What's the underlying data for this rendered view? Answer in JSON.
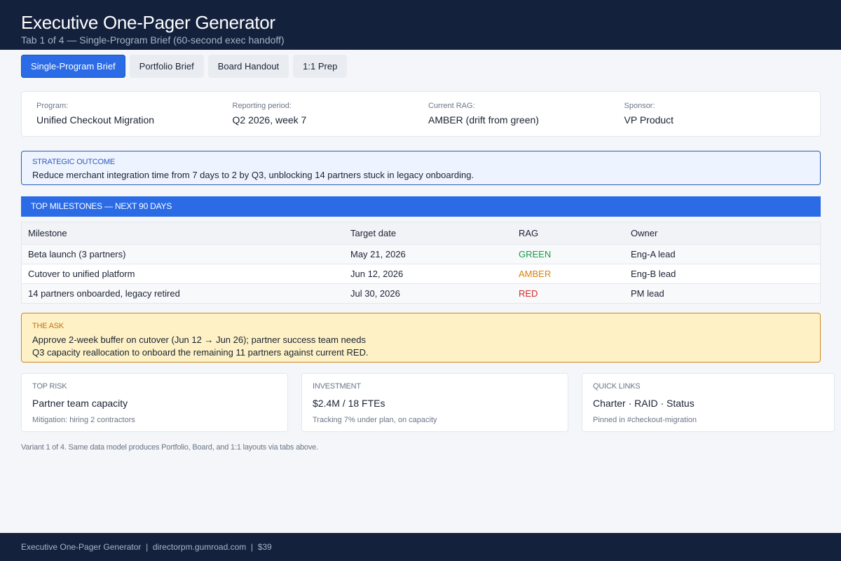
{
  "header": {
    "title": "Executive One-Pager Generator",
    "subtitle": "Tab 1 of 4 — Single-Program Brief (60-second exec handoff)"
  },
  "tabs": [
    {
      "label": "Single-Program Brief",
      "active": true
    },
    {
      "label": "Portfolio Brief",
      "active": false
    },
    {
      "label": "Board Handout",
      "active": false
    },
    {
      "label": "1:1 Prep",
      "active": false
    }
  ],
  "meta": {
    "program_label": "Program:",
    "program_value": "Unified Checkout Migration",
    "period_label": "Reporting period:",
    "period_value": "Q2 2026, week 7",
    "rag_label": "Current RAG:",
    "rag_value": "AMBER (drift from green)",
    "sponsor_label": "Sponsor:",
    "sponsor_value": "VP Product"
  },
  "outcome": {
    "label": "STRATEGIC OUTCOME",
    "text": "Reduce merchant integration time from 7 days to 2 by Q3, unblocking 14 partners stuck in legacy onboarding."
  },
  "milestones": {
    "title": "TOP MILESTONES — NEXT 90 DAYS",
    "headers": [
      "Milestone",
      "Target date",
      "RAG",
      "Owner"
    ],
    "rows": [
      {
        "milestone": "Beta launch (3 partners)",
        "date": "May 21, 2026",
        "rag": "GREEN",
        "owner": "Eng-A lead"
      },
      {
        "milestone": "Cutover to unified platform",
        "date": "Jun 12, 2026",
        "rag": "AMBER",
        "owner": "Eng-B lead"
      },
      {
        "milestone": "14 partners onboarded, legacy retired",
        "date": "Jul 30, 2026",
        "rag": "RED",
        "owner": "PM lead"
      }
    ]
  },
  "ask": {
    "label": "THE ASK",
    "line1": "Approve 2-week buffer on cutover (Jun 12 → Jun 26); partner success team needs",
    "line2": "Q3 capacity reallocation to onboard the remaining 11 partners against current RED."
  },
  "cards": {
    "risk": {
      "label": "TOP RISK",
      "value": "Partner team capacity",
      "note": "Mitigation: hiring 2 contractors"
    },
    "investment": {
      "label": "INVESTMENT",
      "value": "$2.4M / 18 FTEs",
      "note": "Tracking 7% under plan, on capacity"
    },
    "links": {
      "label": "QUICK LINKS",
      "value": "Charter · RAID · Status",
      "note": "Pinned in #checkout-migration"
    }
  },
  "variant_note": "Variant 1 of 4. Same data model produces Portfolio, Board, and 1:1 layouts via tabs above.",
  "footer": {
    "text": "Executive One-Pager Generator  |  directorpm.gumroad.com  |  $39"
  },
  "colors": {
    "header_bg": "#13213c",
    "accent": "#2b6be6",
    "green": "#1a9a4a",
    "amber": "#d9820f",
    "red": "#d42a2a"
  }
}
